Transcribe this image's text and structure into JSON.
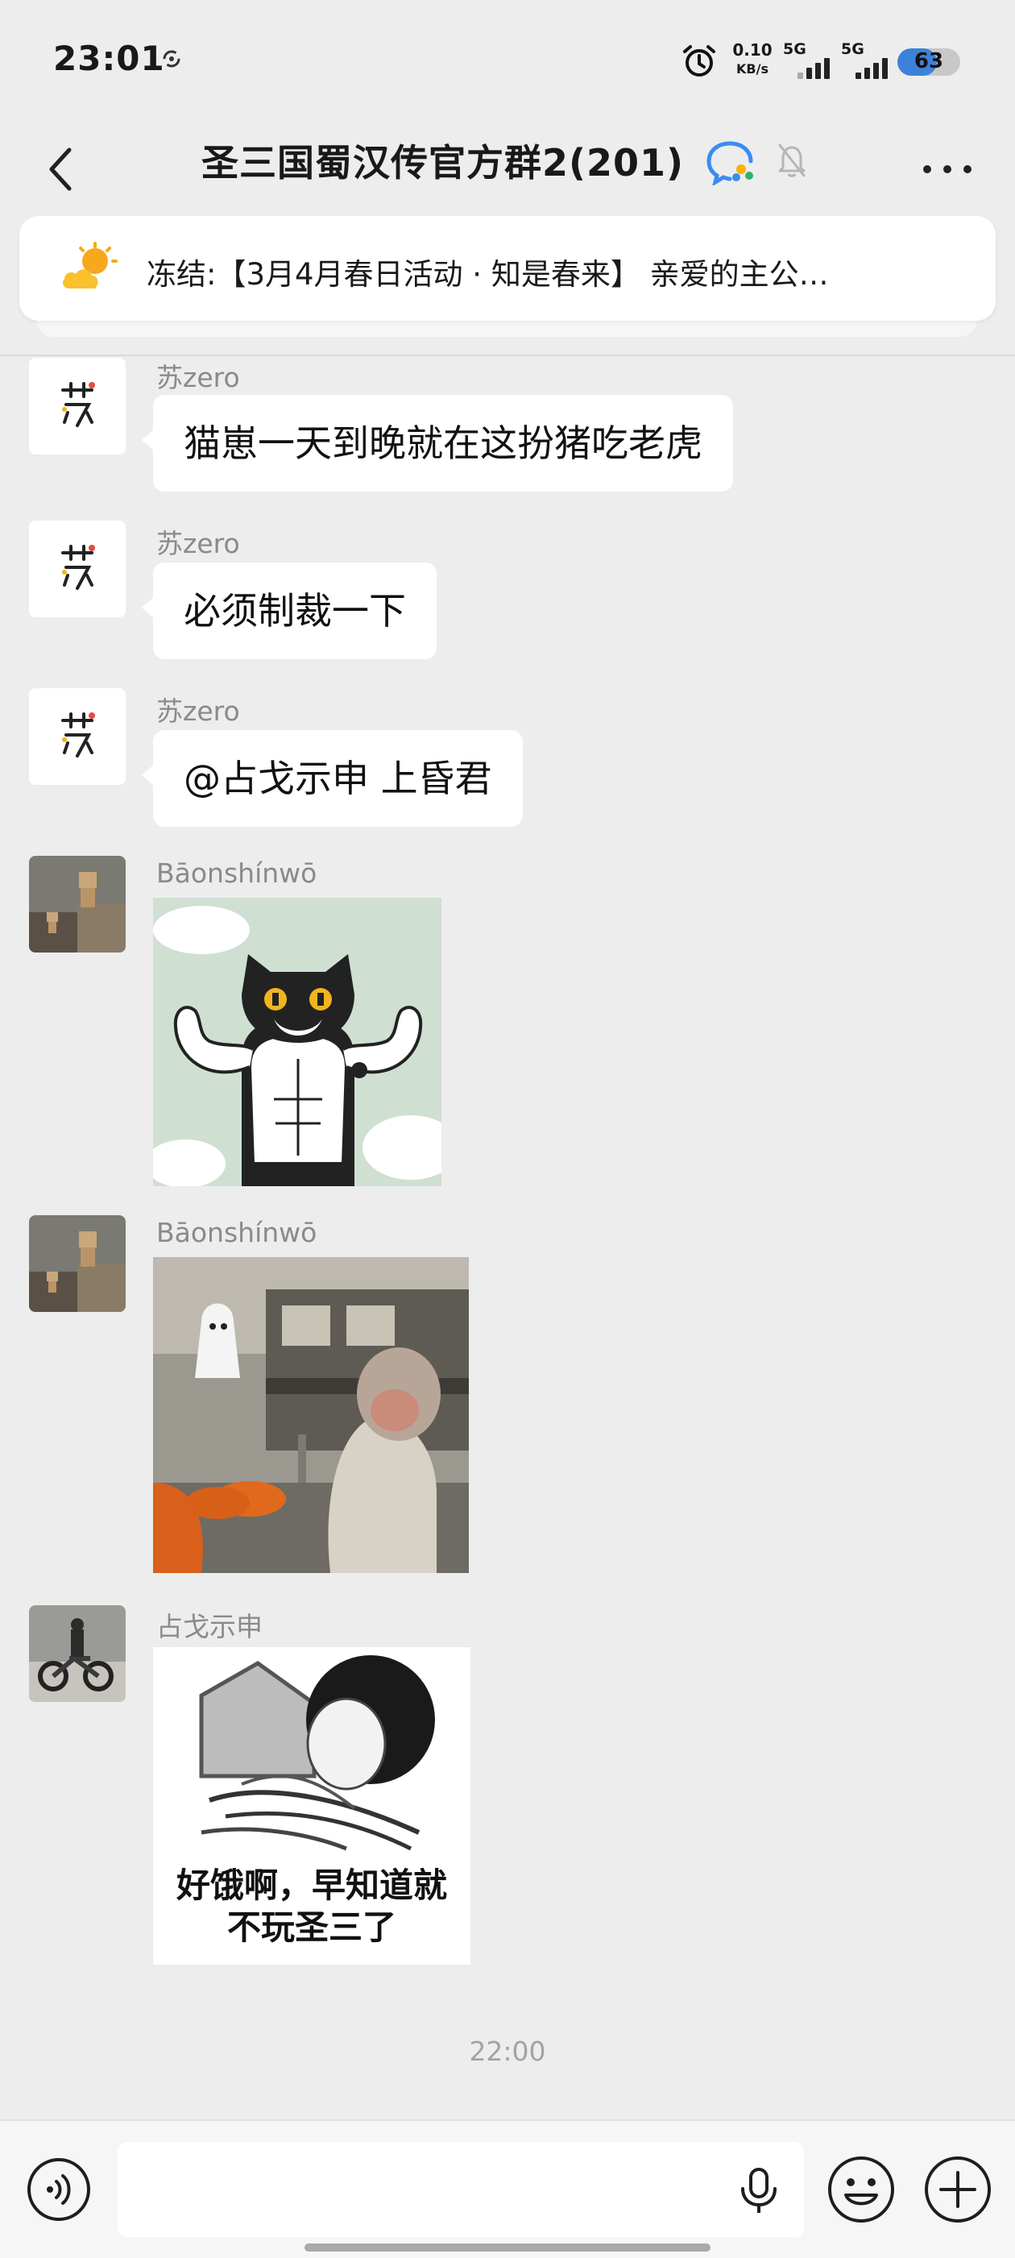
{
  "status_bar": {
    "time": "23:01",
    "net_speed_value": "0.10",
    "net_speed_unit": "KB/s",
    "sim1_label": "5G",
    "sim2_label": "5G",
    "battery": "63",
    "battery_level": 0.63
  },
  "nav": {
    "title": "圣三国蜀汉传官方群2(201)"
  },
  "pinned": {
    "text": "冻结:【3月4月春日活动 · 知是春来】  亲爱的主公…"
  },
  "messages": [
    {
      "sender": "苏zero",
      "text": "猫崽一天到晚就在这扮猪吃老虎",
      "avatar": "avatar-su-zero"
    },
    {
      "sender": "苏zero",
      "text": "必须制裁一下",
      "avatar": "avatar-su-zero"
    },
    {
      "sender": "苏zero",
      "text": "@占戈示申  上昏君",
      "avatar": "avatar-su-zero"
    },
    {
      "sender": "Bāonshínwō",
      "sticker": "muscle-cat-sticker",
      "avatar": "avatar-danbo"
    },
    {
      "sender": "Bāonshínwō",
      "sticker": "monkey-photo-sticker",
      "avatar": "avatar-danbo"
    },
    {
      "sender": "占戈示申",
      "sticker": "meme-sticker",
      "sticker_caption_line1": "好饿啊，早知道就",
      "sticker_caption_line2": "不玩圣三了",
      "avatar": "avatar-motorcycle"
    }
  ],
  "time_divider": "22:00",
  "input": {
    "placeholder": ""
  },
  "colors": {
    "background": "#ededed",
    "bubble": "#ffffff",
    "sender_name": "#8a8a8a",
    "battery_fill": "#3d82d8"
  }
}
